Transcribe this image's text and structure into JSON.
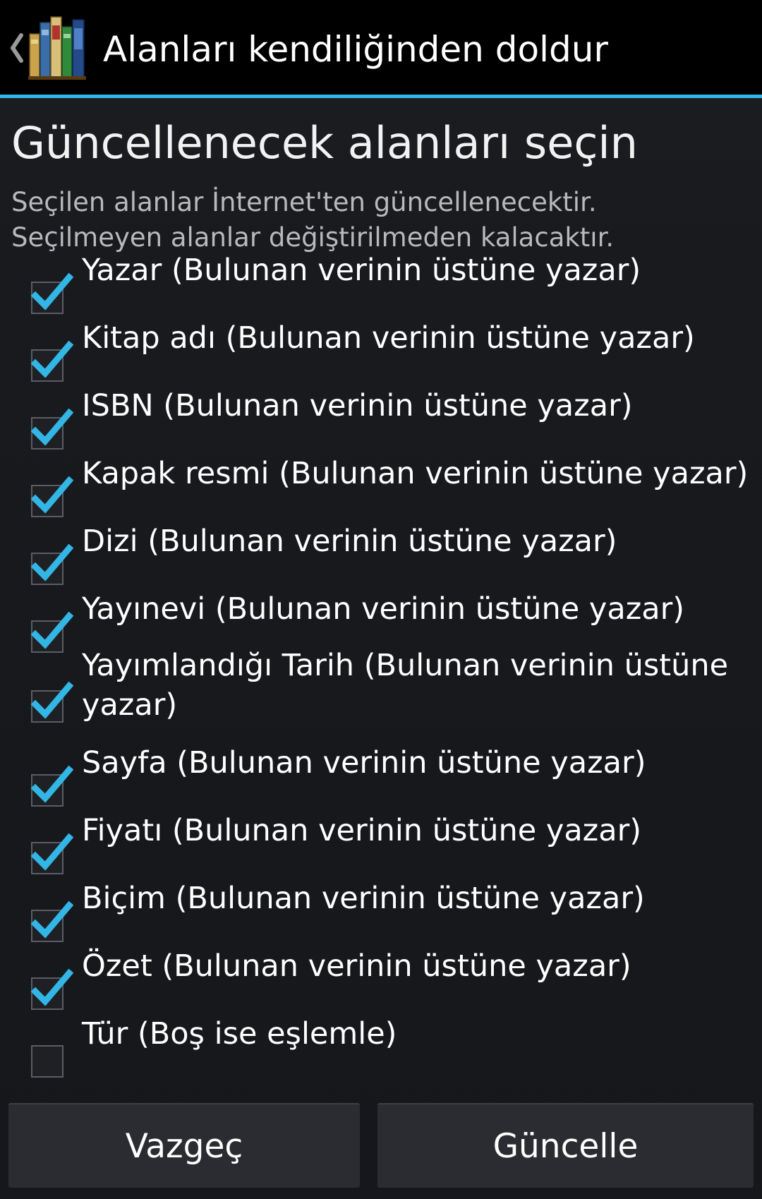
{
  "action_bar": {
    "title": "Alanları kendiliğinden doldur",
    "accent_color": "#33b5e5",
    "icons": [
      "chevron-left-icon",
      "app-books-icon"
    ]
  },
  "dialog": {
    "heading": "Güncellenecek alanları seçin",
    "description": "Seçilen alanlar İnternet'ten güncellenecektir. Seçilmeyen alanlar değiştirilmeden kalacaktır.",
    "fields": [
      {
        "label": "Yazar (Bulunan verinin üstüne yazar)",
        "checked": true
      },
      {
        "label": "Kitap adı (Bulunan verinin üstüne yazar)",
        "checked": true
      },
      {
        "label": "ISBN (Bulunan verinin üstüne yazar)",
        "checked": true
      },
      {
        "label": "Kapak resmi (Bulunan verinin üstüne yazar)",
        "checked": true
      },
      {
        "label": "Dizi (Bulunan verinin üstüne yazar)",
        "checked": true
      },
      {
        "label": "Yayınevi (Bulunan verinin üstüne yazar)",
        "checked": true
      },
      {
        "label": "Yayımlandığı Tarih (Bulunan verinin üstüne yazar)",
        "checked": true
      },
      {
        "label": "Sayfa (Bulunan verinin üstüne yazar)",
        "checked": true
      },
      {
        "label": "Fiyatı (Bulunan verinin üstüne yazar)",
        "checked": true
      },
      {
        "label": "Biçim (Bulunan verinin üstüne yazar)",
        "checked": true
      },
      {
        "label": "Özet (Bulunan verinin üstüne yazar)",
        "checked": true
      },
      {
        "label": "Tür (Boş ise eşlemle)",
        "checked": false
      }
    ],
    "check_color": "#33b5e5"
  },
  "buttons": {
    "cancel_label": "Vazgeç",
    "update_label": "Güncelle"
  }
}
